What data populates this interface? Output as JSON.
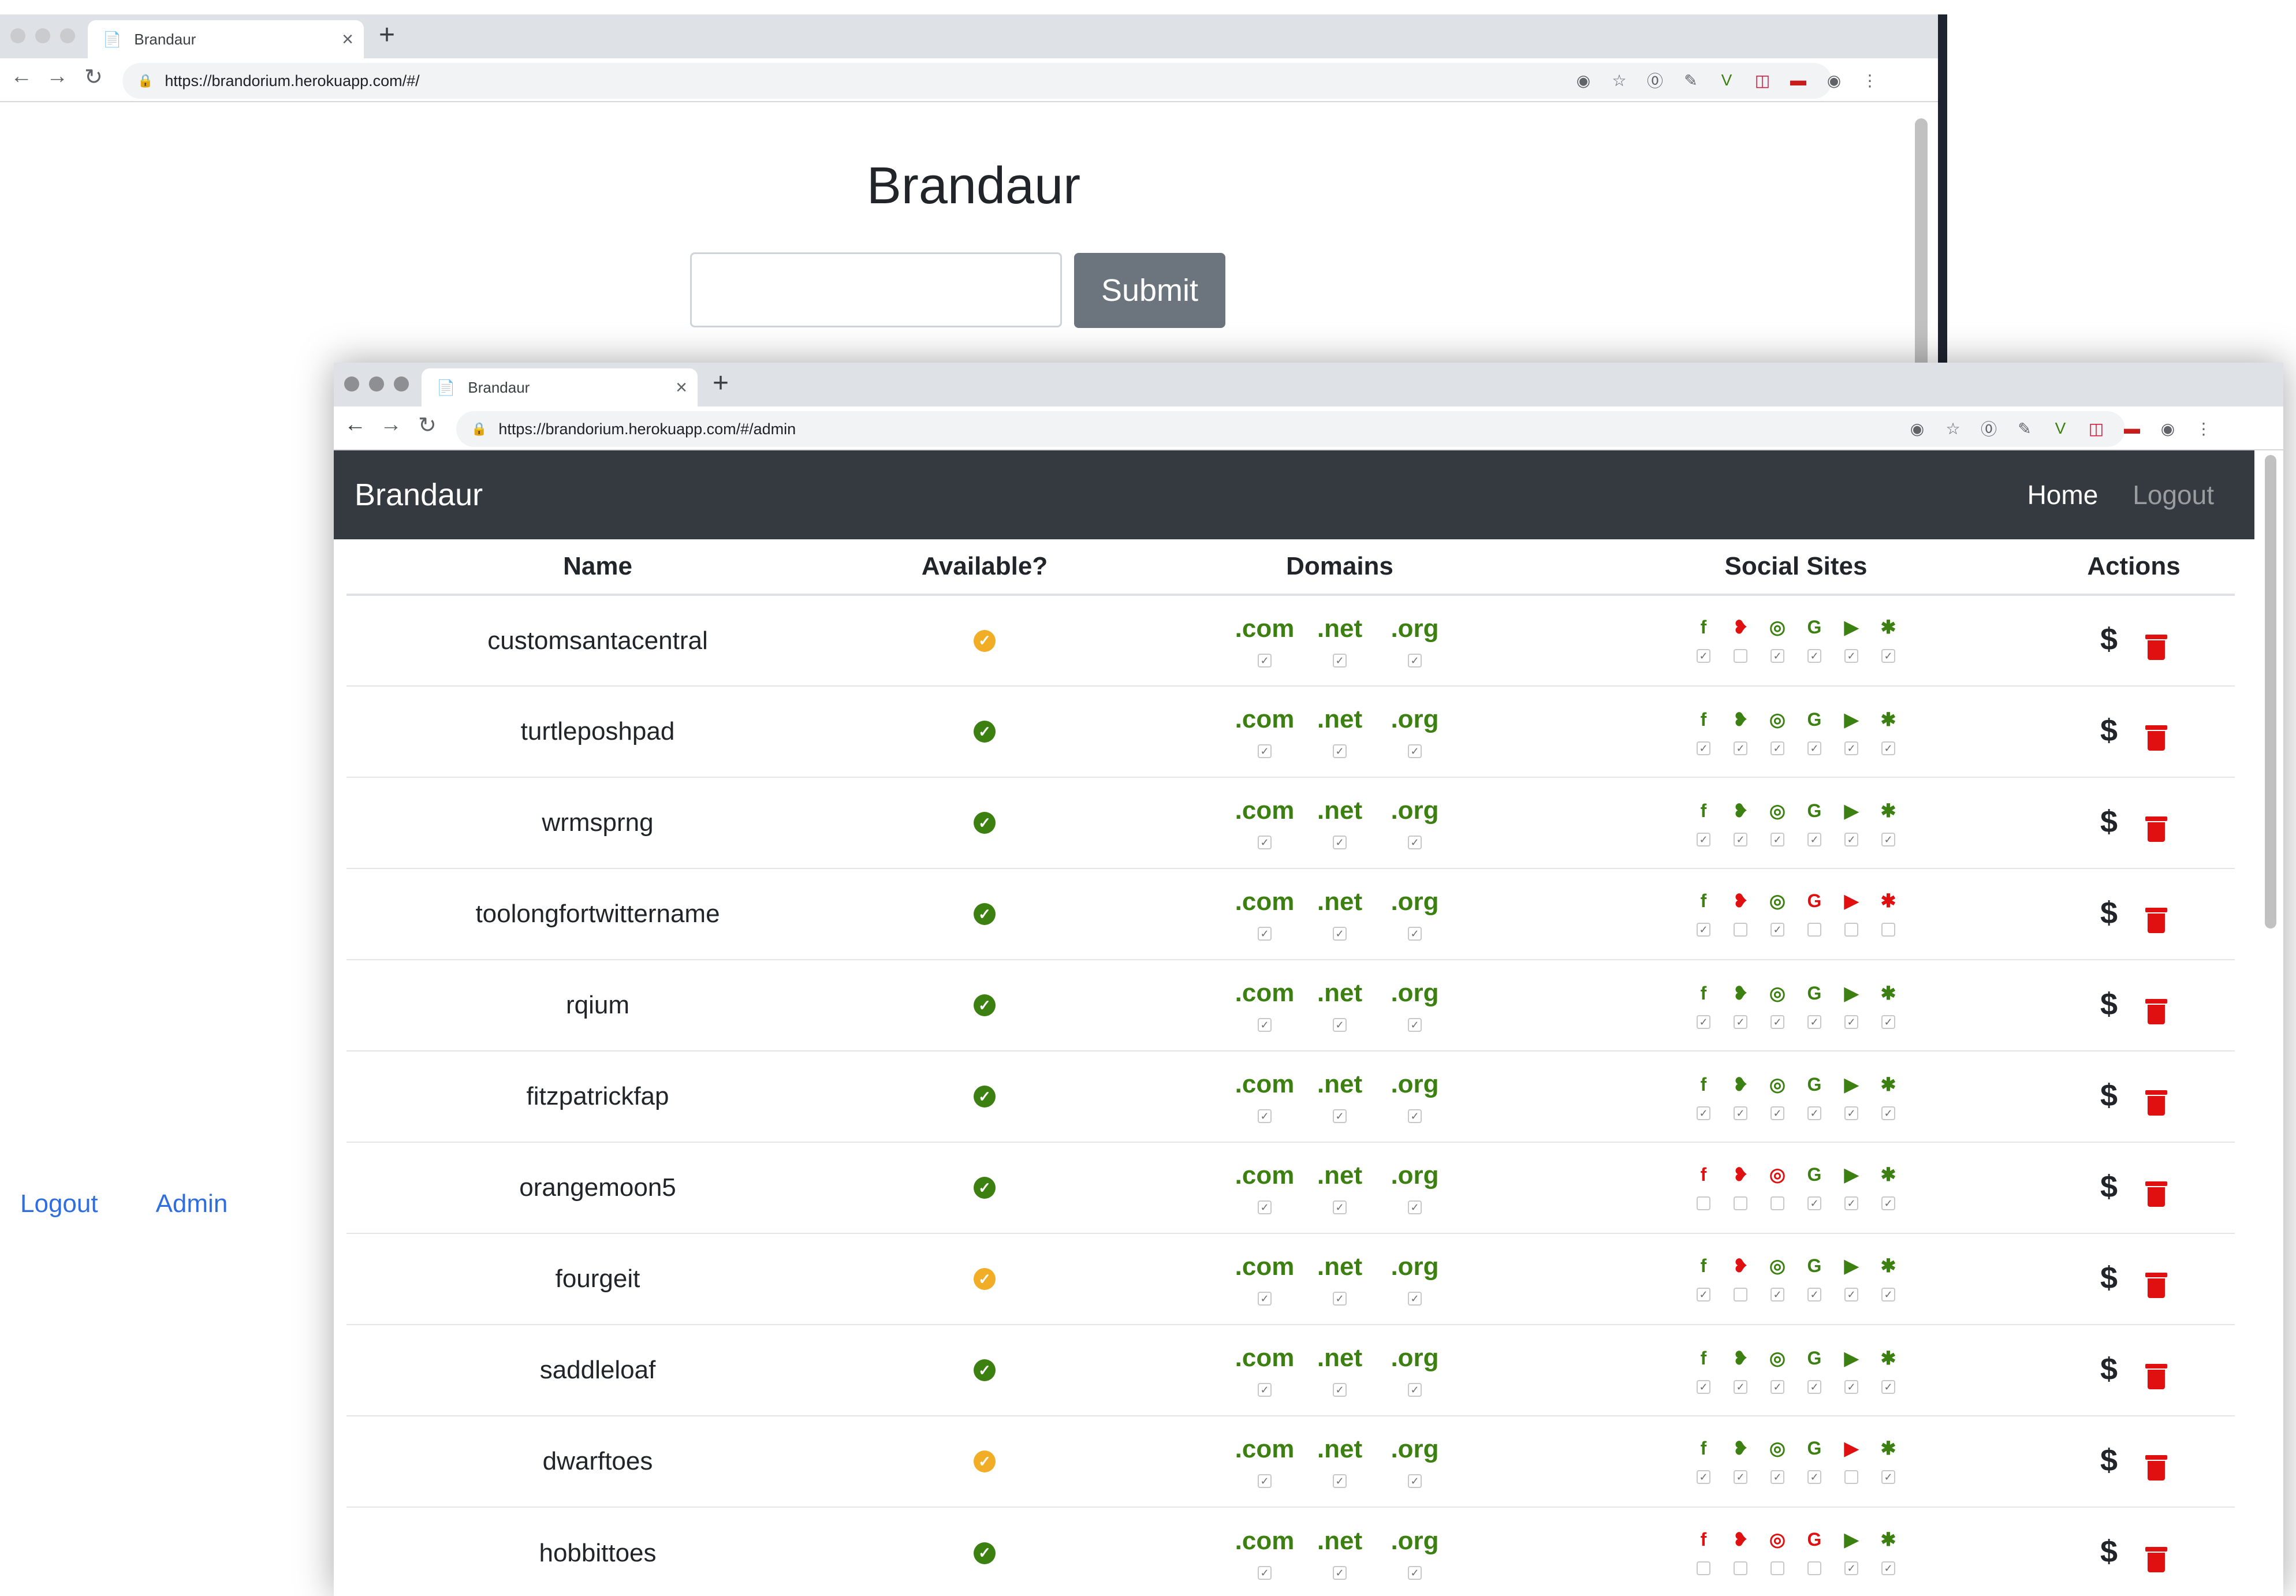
{
  "back_window": {
    "tab_title": "Brandaur",
    "url": "https://brandorium.herokuapp.com/#/",
    "heading": "Brandaur",
    "input_value": "",
    "submit_label": "Submit",
    "links": [
      "Logout",
      "Admin"
    ]
  },
  "front_window": {
    "tab_title": "Brandaur",
    "url": "https://brandorium.herokuapp.com/#/admin",
    "navbar": {
      "brand": "Brandaur",
      "home": "Home",
      "logout": "Logout"
    },
    "columns": [
      "Name",
      "Available?",
      "Domains",
      "Social Sites",
      "Actions"
    ],
    "domain_labels": [
      ".com",
      ".net",
      ".org"
    ],
    "social_icons": [
      "facebook-icon",
      "twitter-icon",
      "instagram-icon",
      "google-icon",
      "youtube-icon",
      "slack-icon"
    ],
    "actions": {
      "buy_icon": "$",
      "delete_icon": "trash-icon"
    },
    "rows": [
      {
        "name": "customsantacentral",
        "available": "partial",
        "domains": [
          true,
          true,
          true
        ],
        "social_available": [
          true,
          false,
          true,
          true,
          true,
          true
        ]
      },
      {
        "name": "turtleposhpad",
        "available": "yes",
        "domains": [
          true,
          true,
          true
        ],
        "social_available": [
          true,
          true,
          true,
          true,
          true,
          true
        ]
      },
      {
        "name": "wrmsprng",
        "available": "yes",
        "domains": [
          true,
          true,
          true
        ],
        "social_available": [
          true,
          true,
          true,
          true,
          true,
          true
        ]
      },
      {
        "name": "toolongfortwittername",
        "available": "yes",
        "domains": [
          true,
          true,
          true
        ],
        "social_available": [
          true,
          false,
          true,
          false,
          false,
          false
        ]
      },
      {
        "name": "rqium",
        "available": "yes",
        "domains": [
          true,
          true,
          true
        ],
        "social_available": [
          true,
          true,
          true,
          true,
          true,
          true
        ]
      },
      {
        "name": "fitzpatrickfap",
        "available": "yes",
        "domains": [
          true,
          true,
          true
        ],
        "social_available": [
          true,
          true,
          true,
          true,
          true,
          true
        ]
      },
      {
        "name": "orangemoon5",
        "available": "yes",
        "domains": [
          true,
          true,
          true
        ],
        "social_available": [
          false,
          false,
          false,
          true,
          true,
          true
        ]
      },
      {
        "name": "fourgeit",
        "available": "partial",
        "domains": [
          true,
          true,
          true
        ],
        "social_available": [
          true,
          false,
          true,
          true,
          true,
          true
        ]
      },
      {
        "name": "saddleloaf",
        "available": "yes",
        "domains": [
          true,
          true,
          true
        ],
        "social_available": [
          true,
          true,
          true,
          true,
          true,
          true
        ]
      },
      {
        "name": "dwarftoes",
        "available": "partial",
        "domains": [
          true,
          true,
          true
        ],
        "social_available": [
          true,
          true,
          true,
          true,
          false,
          true
        ]
      },
      {
        "name": "hobbittoes",
        "available": "yes",
        "domains": [
          true,
          true,
          true
        ],
        "social_available": [
          false,
          false,
          false,
          false,
          true,
          true
        ]
      }
    ]
  },
  "colors": {
    "ok": "#3b8010",
    "bad": "#e01010",
    "partial": "#f0ad25",
    "navbar": "#343a40",
    "link": "#2f6ee0"
  }
}
